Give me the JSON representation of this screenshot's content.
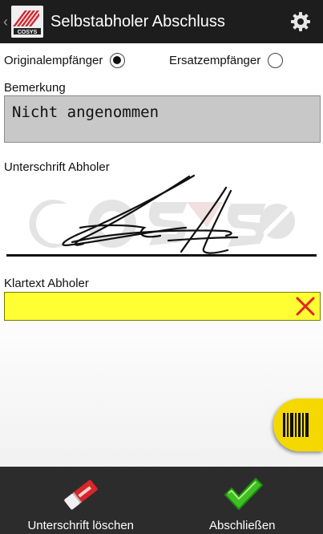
{
  "header": {
    "title": "Selbstabholer Abschluss",
    "back_icon": "chevron-left-icon",
    "logo_text": "COSYS",
    "settings_icon": "gear-icon"
  },
  "recipient": {
    "options": [
      {
        "label": "Originalempfänger",
        "checked": true
      },
      {
        "label": "Ersatzempfänger",
        "checked": false
      }
    ]
  },
  "remark": {
    "label": "Bemerkung",
    "value": "Nicht angenommen"
  },
  "signature": {
    "label": "Unterschrift Abholer",
    "watermark_text": "COSYS"
  },
  "plain_name": {
    "label": "Klartext Abholer",
    "value": "",
    "clear_icon": "close-icon",
    "background_color": "#ffff33"
  },
  "scan_button": {
    "icon": "barcode-icon",
    "color": "#f5d800"
  },
  "bottom_bar": {
    "clear_signature_label": "Unterschrift löschen",
    "clear_signature_icon": "eraser-icon",
    "finish_label": "Abschließen",
    "finish_icon": "checkmark-icon"
  }
}
